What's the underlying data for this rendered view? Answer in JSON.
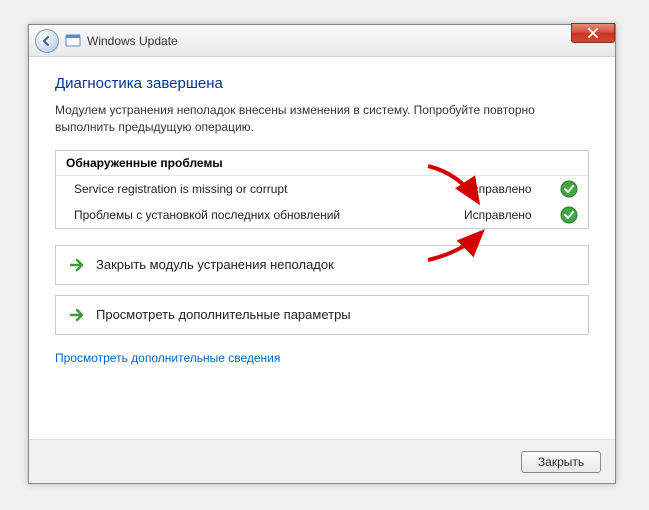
{
  "titlebar": {
    "title": "Windows Update"
  },
  "main": {
    "heading": "Диагностика завершена",
    "subtext": "Модулем устранения неполадок внесены изменения в систему. Попробуйте повторно выполнить предыдущую операцию.",
    "problems_header": "Обнаруженные проблемы",
    "problems": [
      {
        "name": "Service registration is missing or corrupt",
        "status": "Исправлено"
      },
      {
        "name": "Проблемы с установкой последних обновлений",
        "status": "Исправлено"
      }
    ],
    "action_close": "Закрыть модуль устранения неполадок",
    "action_more": "Просмотреть дополнительные параметры",
    "link_details": "Просмотреть дополнительные сведения"
  },
  "footer": {
    "close_label": "Закрыть"
  }
}
